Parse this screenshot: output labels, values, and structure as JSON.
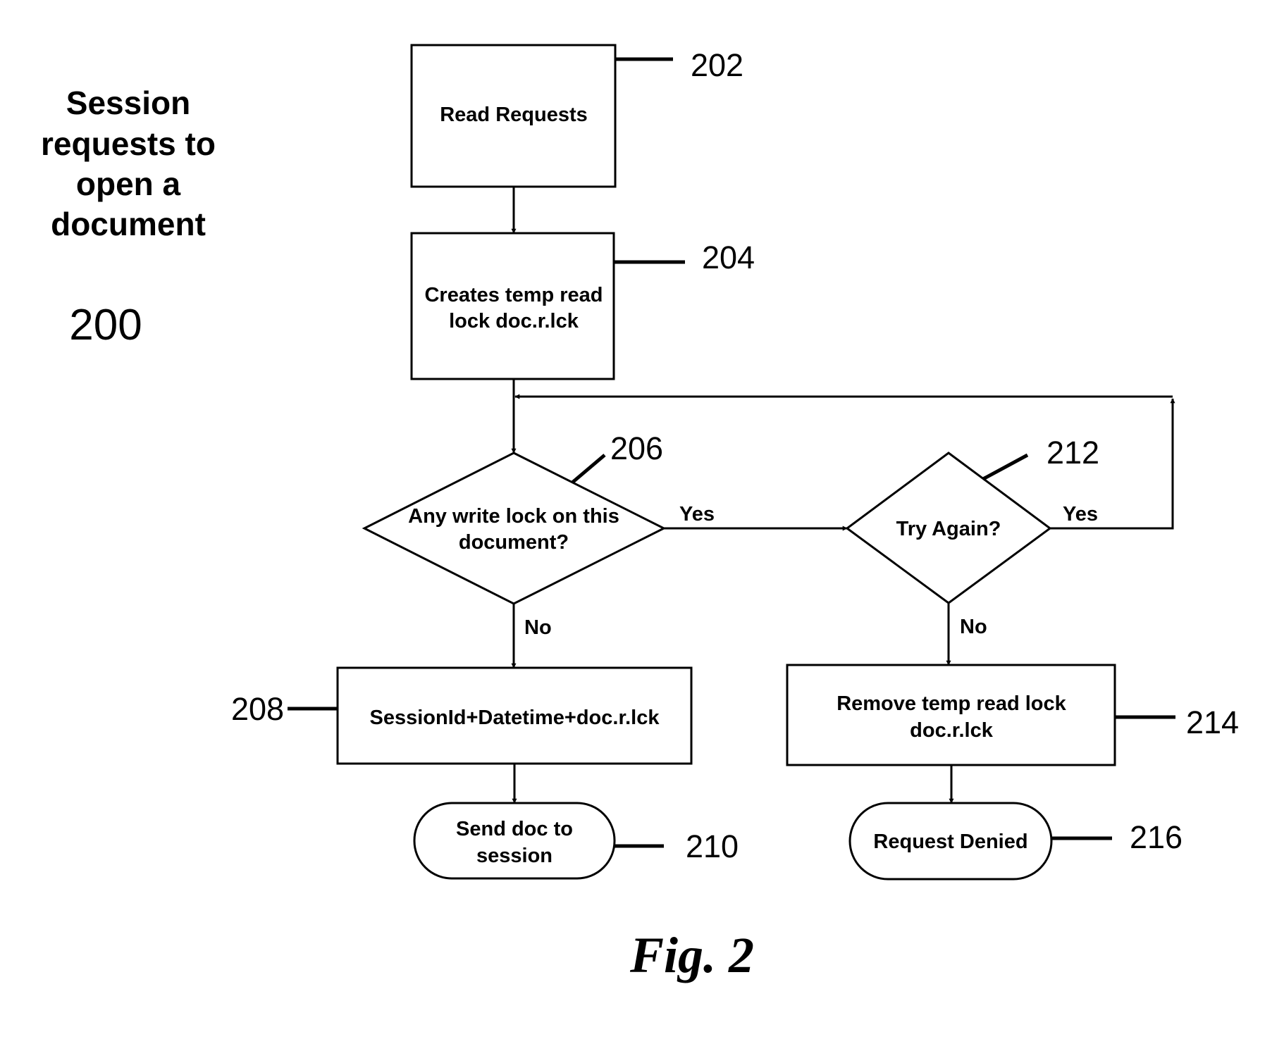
{
  "figure": {
    "caption": "Fig. 2",
    "number": "200",
    "title_lines": [
      "Session",
      "requests to",
      "open a",
      "document"
    ]
  },
  "nodes": {
    "n202": {
      "ref": "202",
      "shape": "process",
      "lines": [
        "Read Requests"
      ]
    },
    "n204": {
      "ref": "204",
      "shape": "process",
      "lines": [
        "Creates temp read",
        "lock doc.r.lck"
      ]
    },
    "n206": {
      "ref": "206",
      "shape": "decision",
      "lines": [
        "Any write lock on this",
        "document?"
      ]
    },
    "n208": {
      "ref": "208",
      "shape": "process",
      "lines": [
        "SessionId+Datetime+doc.r.lck"
      ]
    },
    "n210": {
      "ref": "210",
      "shape": "terminator",
      "lines": [
        "Send doc to",
        "session"
      ]
    },
    "n212": {
      "ref": "212",
      "shape": "decision",
      "lines": [
        "Try Again?"
      ]
    },
    "n214": {
      "ref": "214",
      "shape": "process",
      "lines": [
        "Remove temp read lock",
        "doc.r.lck"
      ]
    },
    "n216": {
      "ref": "216",
      "shape": "terminator",
      "lines": [
        "Request Denied"
      ]
    }
  },
  "edges": [
    {
      "from": "202",
      "to": "204",
      "label": ""
    },
    {
      "from": "204",
      "to": "206",
      "label": ""
    },
    {
      "from": "206",
      "to": "212",
      "label": "Yes"
    },
    {
      "from": "206",
      "to": "208",
      "label": "No"
    },
    {
      "from": "208",
      "to": "210",
      "label": ""
    },
    {
      "from": "212",
      "to": "206",
      "label": "Yes"
    },
    {
      "from": "212",
      "to": "214",
      "label": "No"
    },
    {
      "from": "214",
      "to": "216",
      "label": ""
    }
  ],
  "branch_labels": {
    "d206_yes": "Yes",
    "d206_no": "No",
    "d212_yes": "Yes",
    "d212_no": "No"
  }
}
